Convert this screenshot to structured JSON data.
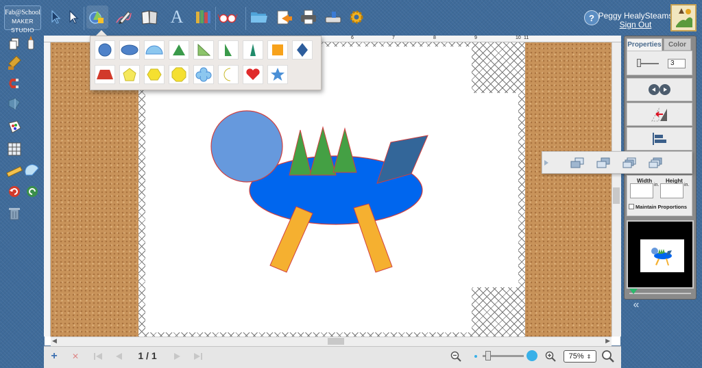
{
  "app": {
    "logo_line1": "Fab@School",
    "logo_line2": "MAKER STUDIO"
  },
  "toolbar": {
    "icons": [
      "select-arrow-icon",
      "direct-select-icon",
      "shapes-icon",
      "pencil-icon",
      "book-icon",
      "text-icon",
      "library-icon",
      "preview-glasses-icon",
      "open-folder-icon",
      "export-icon",
      "print-icon",
      "cut-machine-icon",
      "settings-gear-icon"
    ],
    "text_tool_glyph": "A"
  },
  "user": {
    "help_label": "?",
    "name": "Peggy HealySteams",
    "sign_out": "Sign Out"
  },
  "left_tools": [
    "copy-icon",
    "glue-icon",
    "stamp-icon",
    "magnet-icon",
    "fold-icon",
    "paint-icon",
    "grid-icon",
    "ruler-icon",
    "protractor-icon",
    "undo-icon",
    "redo-icon",
    "trash-icon"
  ],
  "ruler": {
    "labels": [
      "6",
      "7",
      "8",
      "9",
      "10",
      "11"
    ]
  },
  "shape_palette": {
    "items": [
      "circle",
      "ellipse",
      "semicircle",
      "isosceles-triangle",
      "right-triangle",
      "right-triangle-tall",
      "narrow-triangle",
      "square",
      "diamond",
      "trapezoid",
      "pentagon",
      "hexagon",
      "octagon",
      "cloud",
      "moon",
      "heart",
      "star"
    ],
    "colors": {
      "blue": "#4e82c9",
      "green": "#3a9a4a",
      "lightgreen": "#8cc46b",
      "orange": "#f7a21b",
      "red": "#d23a2a",
      "yellow": "#f5e85c",
      "lightblue": "#8cc7ef",
      "heart": "#e02b2b",
      "star": "#4a8fd6"
    }
  },
  "canvas": {
    "colors": {
      "body": "#0066ee",
      "head": "#6699dd",
      "spikes": "#44a044",
      "tail": "#336699",
      "legs": "#f5b030",
      "outline": "#d04040"
    }
  },
  "pagination": {
    "page": "1 / 1"
  },
  "zoom": {
    "value": "75%"
  },
  "right_panel": {
    "tab_properties": "Properties",
    "tab_color": "Color",
    "stroke_value": "3",
    "width_label": "Width",
    "height_label": "Height",
    "unit": "in.",
    "maintain": "Maintain Proportions",
    "collapse": "«"
  }
}
